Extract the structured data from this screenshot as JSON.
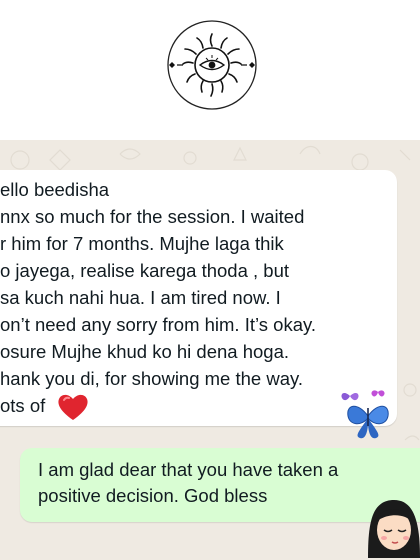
{
  "colors": {
    "chat_background": "#efeae2",
    "incoming_bubble": "#ffffff",
    "outgoing_bubble": "#d9fdd3",
    "text": "#111b21",
    "heart": "#e0252f",
    "butterfly": "#3a79d8"
  },
  "incoming_message": {
    "lines": [
      "ello beedisha",
      "nnx so much for the session. I waited",
      "r him for 7 months. Mujhe laga thik",
      "o jayega, realise karega thoda , but",
      "sa kuch nahi hua. I am tired now. I",
      "on’t need any sorry from him. It’s okay.",
      "osure Mujhe khud ko hi dena hoga.",
      "hank you di, for showing me the way.",
      "ots of"
    ],
    "emoji": [
      "red-heart-icon",
      "butterfly-icon"
    ]
  },
  "outgoing_message": {
    "lines": [
      "I am glad dear that you have taken a",
      "positive decision. God bless"
    ],
    "sticker": "girl-avatar-icon"
  },
  "logo": {
    "icon": "sun-eye-emblem-icon"
  }
}
